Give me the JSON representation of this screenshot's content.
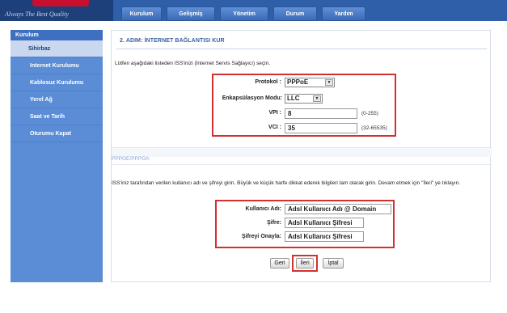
{
  "header": {
    "slogan": "Always The Best Quality",
    "tabs": [
      "Kurulum",
      "Gelişmiş",
      "Yönetim",
      "Durum",
      "Yardım"
    ]
  },
  "sidebar": {
    "title": "Kurulum",
    "items": [
      {
        "label": "Sihirbaz",
        "active": true
      },
      {
        "label": "Internet Kurulumu",
        "active": false
      },
      {
        "label": "Kablosuz Kurulumu",
        "active": false
      },
      {
        "label": "Yerel Ağ",
        "active": false
      },
      {
        "label": "Saat ve Tarih",
        "active": false
      },
      {
        "label": "Oturumu Kapat",
        "active": false
      }
    ]
  },
  "main": {
    "step_title": "2. ADIM: İNTERNET BAĞLANTISI KUR",
    "intro": "Lütfen aşağıdaki listeden ISS'inizi (İnternet Servis Sağlayıcı) seçin.",
    "protocol": {
      "label": "Protokol :",
      "value": "PPPoE"
    },
    "encapsulation": {
      "label": "Enkapsülasyon Modu:",
      "value": "LLC"
    },
    "vpi": {
      "label": "VPI :",
      "value": "8",
      "range": "(0-255)"
    },
    "vci": {
      "label": "VCI :",
      "value": "35",
      "range": "(32-65535)"
    },
    "section_title": "PPPOE/PPPOA",
    "section_desc": "ISS'iniz tarafından verilen kullanıcı adı ve şifreyi girin. Büyük ve küçük harfe dikkat ederek bilgileri tam olarak girin. Devam etmek için \"İleri\" ye tıklayın.",
    "username": {
      "label": "Kullanıcı Adı:",
      "value": "Adsl Kullanıcı Adı @ Domain"
    },
    "password": {
      "label": "Şifre:",
      "value": "Adsl Kullanıcı Şifresi"
    },
    "confirm_password": {
      "label": "Şifreyi Onayla:",
      "value": "Adsl Kullanıcı Şifresi"
    },
    "buttons": {
      "back": "Geri",
      "next": "İleri",
      "cancel": "İptal"
    }
  },
  "colors": {
    "header_blue": "#2f5fa8",
    "sidebar_blue": "#5b8dd6",
    "highlight_red": "#d23131",
    "title_blue": "#3a5fa0"
  }
}
